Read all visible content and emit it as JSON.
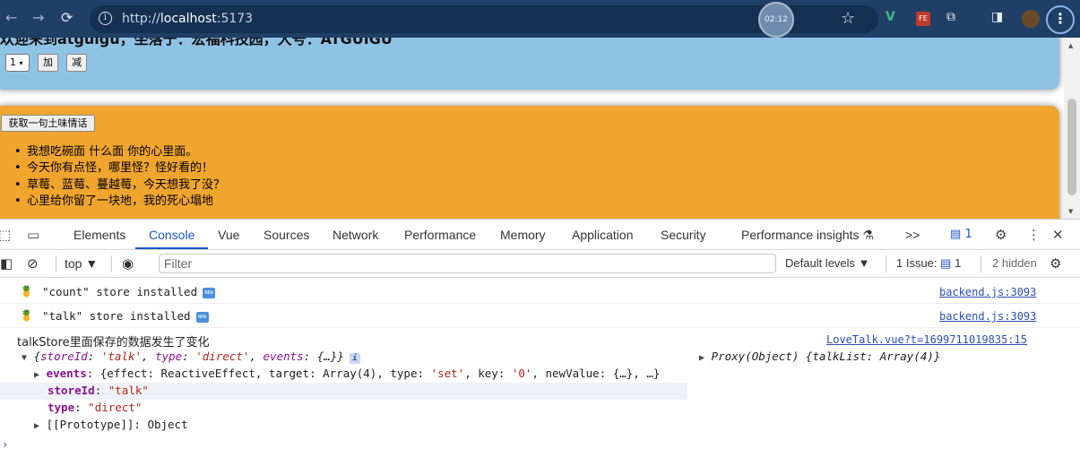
{
  "browser": {
    "url_prefix": "http://",
    "url_host": "localhost",
    "url_port": ":5173",
    "timer": "02:12"
  },
  "page": {
    "blue_title": "欢迎来到atguigu，坐落于：宏福科技园，大号：ATGUIGU",
    "select_value": "1",
    "add_label": "加",
    "sub_label": "减",
    "get_talk_label": "获取一句土味情话",
    "talk_list": [
      "我想吃碗面 什么面 你的心里面。",
      "今天你有点怪，哪里怪？怪好看的！",
      "草莓、蓝莓、蔓越莓，今天想我了没？",
      "心里给你留了一块地，我的死心塌地"
    ]
  },
  "devtools": {
    "tabs": [
      "Elements",
      "Console",
      "Vue",
      "Sources",
      "Network",
      "Performance",
      "Memory",
      "Application",
      "Security",
      "Performance insights"
    ],
    "active_tab": "Console",
    "more_tabs": ">>",
    "issue_badge": "1",
    "context": "top",
    "filter_placeholder": "Filter",
    "levels": "Default levels",
    "issues_label": "1 Issue:",
    "issues_count": "1",
    "hidden": "2 hidden"
  },
  "console": {
    "msg1": "\"count\" store installed",
    "msg1_link": "backend.js:3093",
    "msg2": "\"talk\" store installed",
    "msg2_link": "backend.js:3093",
    "msg3": "talkStore里面保存的数据发生了变化",
    "msg3_link": "LoveTalk.vue?t=1699711019835:15",
    "obj_summary_a": "{",
    "obj_summary_key1": "storeId",
    "obj_summary_val1": "'talk'",
    "obj_summary_key2": "type",
    "obj_summary_val2": "'direct'",
    "obj_summary_key3": "events",
    "obj_summary_val3": "{…}}",
    "proxy": "Proxy(Object) {talkList: Array(4)}",
    "events_key": "events",
    "events_text": "{effect: ReactiveEffect, target: Array(4), type: ",
    "events_set": "'set'",
    "events_key_label": ", key: ",
    "events_zero": "'0'",
    "events_tail": ", newValue: {…}, …}",
    "storeId_key": "storeId",
    "storeId_val": "\"talk\"",
    "type_key": "type",
    "type_val": "\"direct\"",
    "proto": "[[Prototype]]: Object"
  }
}
